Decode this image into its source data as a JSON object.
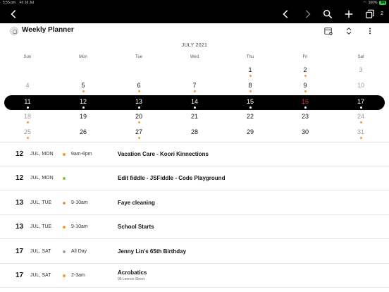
{
  "status_bar": {
    "time": "5:55 pm",
    "date": "Fri 16 Jul",
    "battery": "100%",
    "battery_badge": "94"
  },
  "nav": {
    "duplicate_count": "2"
  },
  "header": {
    "title": "Weekly Planner"
  },
  "calendar": {
    "month": "JULY 2021",
    "weekdays": [
      "Sun",
      "Mon",
      "Tue",
      "Wed",
      "Thu",
      "Fri",
      "Sat"
    ],
    "weeks": [
      [
        {
          "day": "",
          "dim": false,
          "dot": false
        },
        {
          "day": "",
          "dim": false,
          "dot": false
        },
        {
          "day": "",
          "dim": false,
          "dot": false
        },
        {
          "day": "",
          "dim": false,
          "dot": false
        },
        {
          "day": "1",
          "dim": false,
          "dot": true
        },
        {
          "day": "2",
          "dim": false,
          "dot": true
        },
        {
          "day": "3",
          "dim": true,
          "dot": false
        }
      ],
      [
        {
          "day": "4",
          "dim": true,
          "dot": false
        },
        {
          "day": "5",
          "dim": false,
          "dot": true
        },
        {
          "day": "6",
          "dim": false,
          "dot": true
        },
        {
          "day": "7",
          "dim": false,
          "dot": true
        },
        {
          "day": "8",
          "dim": false,
          "dot": true
        },
        {
          "day": "9",
          "dim": false,
          "dot": true
        },
        {
          "day": "10",
          "dim": true,
          "dot": false
        }
      ],
      [
        {
          "day": "11",
          "dim": false,
          "dot": false
        },
        {
          "day": "12",
          "dim": false,
          "dot": true
        },
        {
          "day": "13",
          "dim": false,
          "dot": true
        },
        {
          "day": "14",
          "dim": false,
          "dot": false
        },
        {
          "day": "15",
          "dim": false,
          "dot": false
        },
        {
          "day": "16",
          "dim": false,
          "dot": false,
          "today": true
        },
        {
          "day": "17",
          "dim": false,
          "dot": true
        }
      ],
      [
        {
          "day": "18",
          "dim": true,
          "dot": true
        },
        {
          "day": "19",
          "dim": false,
          "dot": false
        },
        {
          "day": "20",
          "dim": false,
          "dot": true
        },
        {
          "day": "21",
          "dim": false,
          "dot": false
        },
        {
          "day": "22",
          "dim": false,
          "dot": false
        },
        {
          "day": "23",
          "dim": false,
          "dot": false
        },
        {
          "day": "24",
          "dim": true,
          "dot": true
        }
      ],
      [
        {
          "day": "25",
          "dim": true,
          "dot": true
        },
        {
          "day": "26",
          "dim": false,
          "dot": false
        },
        {
          "day": "27",
          "dim": false,
          "dot": true
        },
        {
          "day": "28",
          "dim": false,
          "dot": false
        },
        {
          "day": "29",
          "dim": false,
          "dot": false
        },
        {
          "day": "30",
          "dim": false,
          "dot": false
        },
        {
          "day": "31",
          "dim": true,
          "dot": true
        }
      ]
    ],
    "selected_week": 2
  },
  "events": [
    {
      "day": "12",
      "date": "JUL, MON",
      "color": "#f0a030",
      "time": "9am-6pm",
      "title": "Vacation Care - Koori Kinnections",
      "subtitle": ""
    },
    {
      "day": "12",
      "date": "JUL, MON",
      "color": "#7ac943",
      "time": "",
      "title": "Edit fiddle - JSFiddle - Code Playground",
      "subtitle": ""
    },
    {
      "day": "13",
      "date": "JUL, TUE",
      "color": "#f0a030",
      "time": "9-10am",
      "title": "Faye cleaning",
      "subtitle": ""
    },
    {
      "day": "13",
      "date": "JUL, TUE",
      "color": "#f0a030",
      "time": "9-10am",
      "title": "School Starts",
      "subtitle": ""
    },
    {
      "day": "17",
      "date": "JUL, SAT",
      "color": "#9aa6b2",
      "time": "All Day",
      "title": "Jenny Lin's 65th Birthday",
      "subtitle": ""
    },
    {
      "day": "17",
      "date": "JUL, SAT",
      "color": "#f0a030",
      "time": "2-3am",
      "title": "Acrobatics",
      "subtitle": "95 Lennox Street"
    }
  ],
  "icons": {
    "back": "chevron-left-icon",
    "prev": "chevron-left-icon",
    "next": "chevron-right-icon",
    "search": "search-icon",
    "add": "plus-icon",
    "duplicate": "duplicate-icon",
    "add_calendar": "calendar-add-icon",
    "expand": "expand-collapse-icon",
    "more": "more-vertical-icon"
  }
}
